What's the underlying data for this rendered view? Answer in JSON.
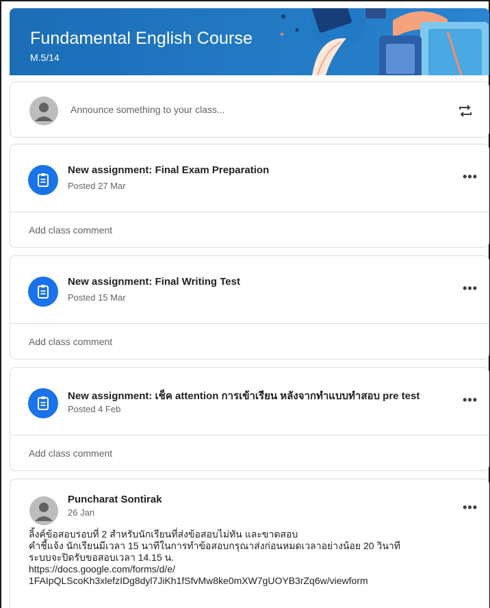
{
  "course": {
    "title": "Fundamental English Course",
    "section": "M.5/14"
  },
  "composer": {
    "placeholder": "Announce something to your class...",
    "repost_icon": "repost-icon"
  },
  "stream": [
    {
      "title": "New assignment: Final Exam Preparation",
      "date": "Posted 27 Mar",
      "comment": "Add class comment"
    },
    {
      "title": "New assignment: Final Writing Test",
      "date": "Posted 15 Mar",
      "comment": "Add class comment"
    },
    {
      "title": "New assignment: เช็ค attention การเข้าเรียน หลังจากทำแบบทำสอบ pre test",
      "date": "Posted 4 Feb",
      "comment": "Add class comment"
    }
  ],
  "post": {
    "author": "Puncharat Sontirak",
    "date": "26 Jan",
    "lines": [
      "ลิ้งค์ข้อสอบรอบที่ 2 สำหรับนักเรียนที่ส่งข้อสอบไม่ทัน และขาดสอบ",
      "คำชี้แจ้ง นักเรียนมีเวลา  15 นาทีในการทำข้อสอบกรุณาส่งก่อนหมดเวลาอย่างน้อย 20 วินาที",
      "ระบบจะปิดรับขอสอบเวลา 14.15 น.",
      "https://docs.google.com/forms/d/e/",
      "1FAIpQLScoKh3xlefzIDg8dyl7JiKh1fSfvMw8ke0mXW7gUOYB3rZq6w/viewform"
    ]
  },
  "more_label": "•••",
  "colors": {
    "banner": "#1c6fb8",
    "assignment_icon": "#1a73e8",
    "border": "#dadce0"
  }
}
